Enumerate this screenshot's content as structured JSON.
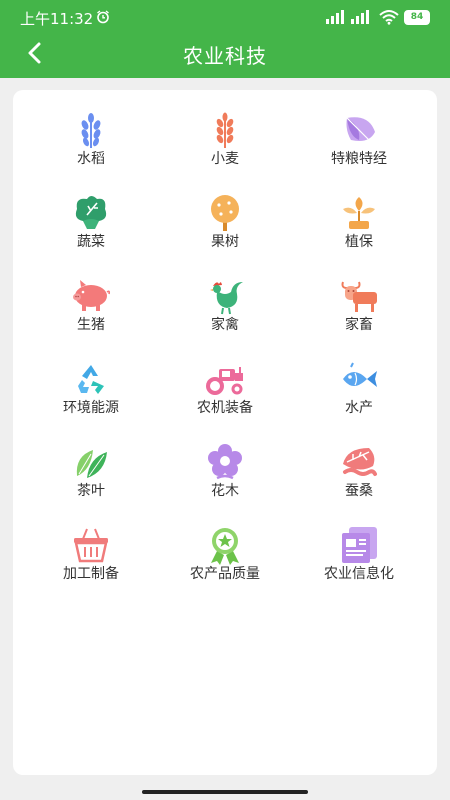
{
  "status_bar": {
    "time": "上午11:32",
    "battery": "84"
  },
  "header": {
    "title": "农业科技"
  },
  "categories": [
    {
      "label": "水稻",
      "icon": "rice-icon",
      "color": "#6b8ff0"
    },
    {
      "label": "小麦",
      "icon": "wheat-icon",
      "color": "#f07b5a"
    },
    {
      "label": "特粮特经",
      "icon": "special-crops-icon",
      "color": "#b789e8"
    },
    {
      "label": "蔬菜",
      "icon": "vegetable-icon",
      "color": "#3db37a"
    },
    {
      "label": "果树",
      "icon": "fruit-tree-icon",
      "color": "#f3a64a"
    },
    {
      "label": "植保",
      "icon": "plant-protection-icon",
      "color": "#f3a64a"
    },
    {
      "label": "生猪",
      "icon": "pig-icon",
      "color": "#f37a7a"
    },
    {
      "label": "家禽",
      "icon": "rooster-icon",
      "color": "#3db37a"
    },
    {
      "label": "家畜",
      "icon": "cattle-icon",
      "color": "#f07b5a"
    },
    {
      "label": "环境能源",
      "icon": "recycle-icon",
      "color": "#42a8e6"
    },
    {
      "label": "农机装备",
      "icon": "tractor-icon",
      "color": "#ec6a9a"
    },
    {
      "label": "水产",
      "icon": "fish-icon",
      "color": "#5aa6f0"
    },
    {
      "label": "茶叶",
      "icon": "tea-leaf-icon",
      "color": "#55c26a"
    },
    {
      "label": "花木",
      "icon": "flower-icon",
      "color": "#b789e8"
    },
    {
      "label": "蚕桑",
      "icon": "mulberry-icon",
      "color": "#f07b7b"
    },
    {
      "label": "加工制备",
      "icon": "basket-icon",
      "color": "#f07b7b"
    },
    {
      "label": "农产品质量",
      "icon": "quality-award-icon",
      "color": "#6cc24a"
    },
    {
      "label": "农业信息化",
      "icon": "info-document-icon",
      "color": "#b789e8"
    }
  ]
}
